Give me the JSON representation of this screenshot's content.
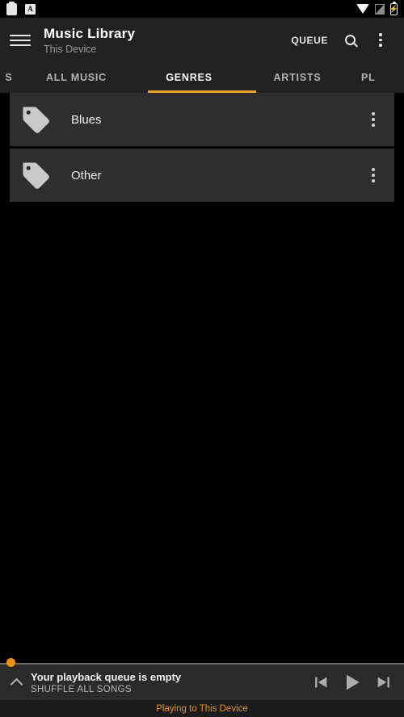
{
  "statusbar": {
    "left_icons": [
      "clipboard-icon",
      "alphabet-a-icon"
    ],
    "alphabet_letter": "A",
    "right_icons": [
      "wifi-icon",
      "no-signal-icon",
      "battery-charging-icon"
    ],
    "battery_glyph": "⚡"
  },
  "toolbar": {
    "menu_icon": "hamburger-menu-icon",
    "title": "Music Library",
    "subtitle": "This Device",
    "queue_label": "QUEUE",
    "search_icon": "search-icon",
    "overflow_icon": "overflow-menu-icon"
  },
  "tabs": {
    "items": [
      {
        "label": "S",
        "active": false,
        "partial": true
      },
      {
        "label": "ALL MUSIC",
        "active": false,
        "partial": false
      },
      {
        "label": "GENRES",
        "active": true,
        "partial": false
      },
      {
        "label": "ARTISTS",
        "active": false,
        "partial": false
      },
      {
        "label": "PL",
        "active": false,
        "partial": true
      }
    ],
    "indicator_color": "#F0A030"
  },
  "list": {
    "items": [
      {
        "icon": "tag-icon",
        "label": "Blues",
        "overflow": "overflow-menu-icon"
      },
      {
        "icon": "tag-icon",
        "label": "Other",
        "overflow": "overflow-menu-icon"
      }
    ]
  },
  "player": {
    "progress_percent": 0,
    "thumb_color": "#F0900F",
    "expand_icon": "chevron-up-icon",
    "title": "Your playback queue is empty",
    "subtitle": "SHUFFLE ALL SONGS",
    "previous_icon": "skip-previous-icon",
    "play_icon": "play-icon",
    "next_icon": "skip-next-icon",
    "cast_text": "Playing to This Device",
    "cast_color": "#E8921E"
  }
}
